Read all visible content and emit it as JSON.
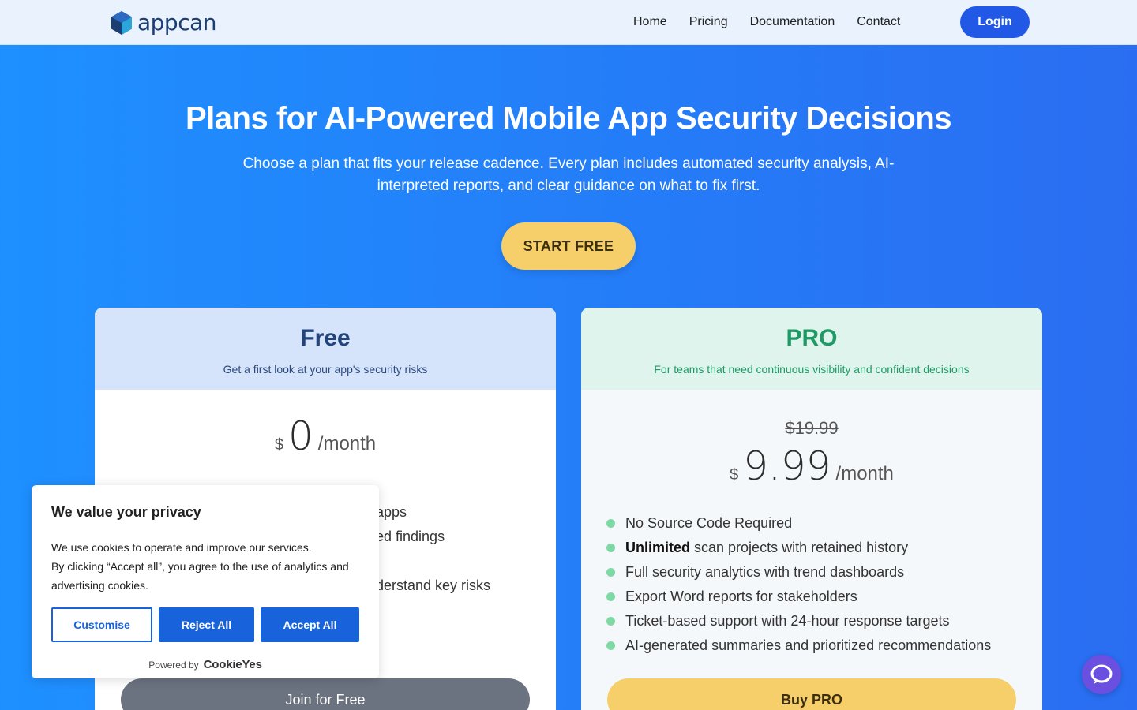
{
  "brand": {
    "name": "appcan"
  },
  "nav": {
    "links": [
      "Home",
      "Pricing",
      "Documentation",
      "Contact"
    ],
    "login_label": "Login"
  },
  "hero": {
    "title": "Plans for AI-Powered Mobile App Security Decisions",
    "subtitle": "Choose a plan that fits your release cadence. Every plan includes automated security analysis, AI-interpreted reports, and clear guidance on what to fix first.",
    "cta_label": "START FREE"
  },
  "plans": {
    "free": {
      "name": "Free",
      "tagline": "Get a first look at your app's security risks",
      "currency": "$",
      "price": "0",
      "period": "/month",
      "features_visible": [
        "apps",
        "ed findings",
        "",
        "derstand key risks"
      ],
      "button_label": "Join for Free"
    },
    "pro": {
      "name": "PRO",
      "tagline": "For teams that need continuous visibility and confident decisions",
      "old_price": "$19.99",
      "currency": "$",
      "price": "9.99",
      "period": "/month",
      "features": [
        {
          "bold": "",
          "text": "No Source Code Required"
        },
        {
          "bold": "Unlimited",
          "text": "scan projects with retained history"
        },
        {
          "bold": "",
          "text": "Full security analytics with trend dashboards"
        },
        {
          "bold": "",
          "text": "Export Word reports for stakeholders"
        },
        {
          "bold": "",
          "text": "Ticket-based support with 24-hour response targets"
        },
        {
          "bold": "",
          "text": "AI-generated summaries and prioritized recommendations"
        }
      ],
      "button_label": "Buy PRO"
    }
  },
  "cookie": {
    "title": "We value your privacy",
    "text_1": "We use cookies to operate and improve our services.",
    "text_2": "By clicking “Accept all”, you agree to the use of analytics and advertising cookies.",
    "customise_label": "Customise",
    "reject_label": "Reject All",
    "accept_label": "Accept All",
    "powered_by": "Powered by",
    "powered_brand": "CookieYes"
  },
  "colors": {
    "accent": "#2159e6",
    "cta": "#f6cf6a",
    "pro_green": "#1f9a66"
  }
}
